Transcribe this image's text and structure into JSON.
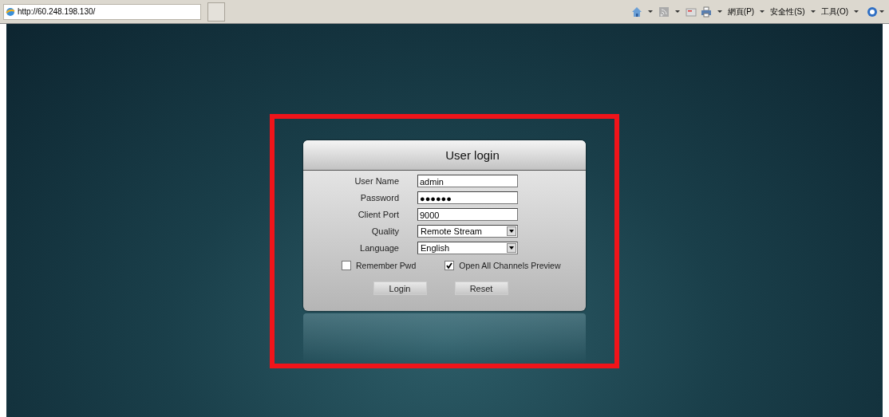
{
  "browser": {
    "address": "http://60.248.198.130/",
    "menus": [
      {
        "label": "網頁(P)"
      },
      {
        "label": "安全性(S)"
      },
      {
        "label": "工具(O)"
      }
    ]
  },
  "login": {
    "title": "User login",
    "fields": [
      {
        "kind": "text",
        "label": "User Name",
        "value": "admin"
      },
      {
        "kind": "text",
        "label": "Password",
        "value": "●●●●●●"
      },
      {
        "kind": "text",
        "label": "Client Port",
        "value": "9000"
      },
      {
        "kind": "select",
        "label": "Quality",
        "value": "Remote Stream"
      },
      {
        "kind": "select",
        "label": "Language",
        "value": "English"
      }
    ],
    "checkboxes": [
      {
        "label": "Remember Pwd",
        "checked": false
      },
      {
        "label": "Open All Channels Preview",
        "checked": true
      }
    ],
    "buttons": [
      "Login",
      "Reset"
    ]
  }
}
